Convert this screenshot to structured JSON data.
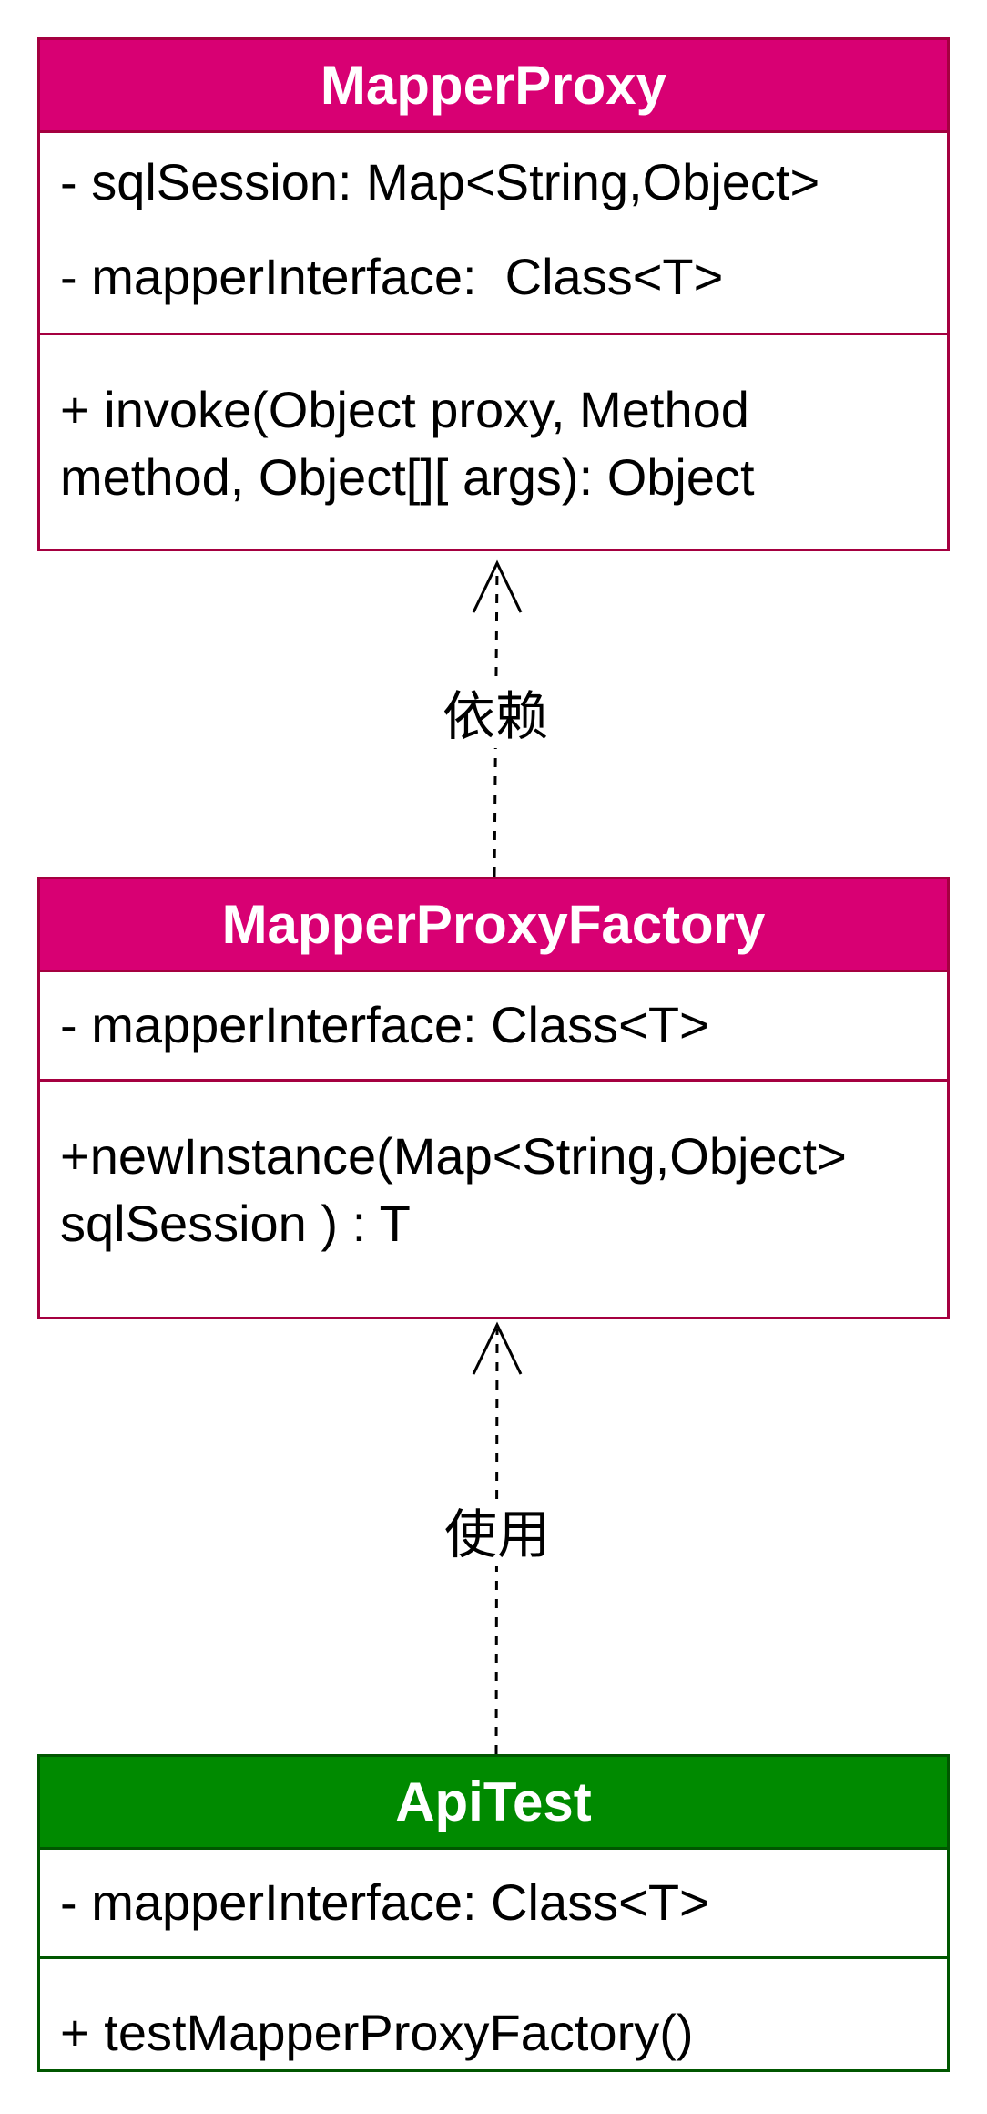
{
  "colors": {
    "class_header_pink": "#d80073",
    "class_border_pink": "#a50040",
    "class_header_green": "#008a00",
    "class_border_green": "#005700",
    "connector": "#000000"
  },
  "classes": {
    "mapper_proxy": {
      "name": "MapperProxy",
      "attributes": [
        "- sqlSession: Map<String,Object>",
        "- mapperInterface:  Class<T>"
      ],
      "methods": [
        "+ invoke(Object proxy, Method",
        "method, Object[][ args): Object"
      ]
    },
    "mapper_proxy_factory": {
      "name": "MapperProxyFactory",
      "attributes": [
        "- mapperInterface: Class<T>"
      ],
      "methods": [
        "+newInstance(Map<String,Object>",
        "sqlSession ) : T"
      ]
    },
    "api_test": {
      "name": "ApiTest",
      "attributes": [
        "- mapperInterface: Class<T>"
      ],
      "methods": [
        "+ testMapperProxyFactory()"
      ]
    }
  },
  "relations": {
    "factory_to_proxy": {
      "label": "依赖",
      "kind": "dependency"
    },
    "test_to_factory": {
      "label": "使用",
      "kind": "dependency"
    }
  }
}
